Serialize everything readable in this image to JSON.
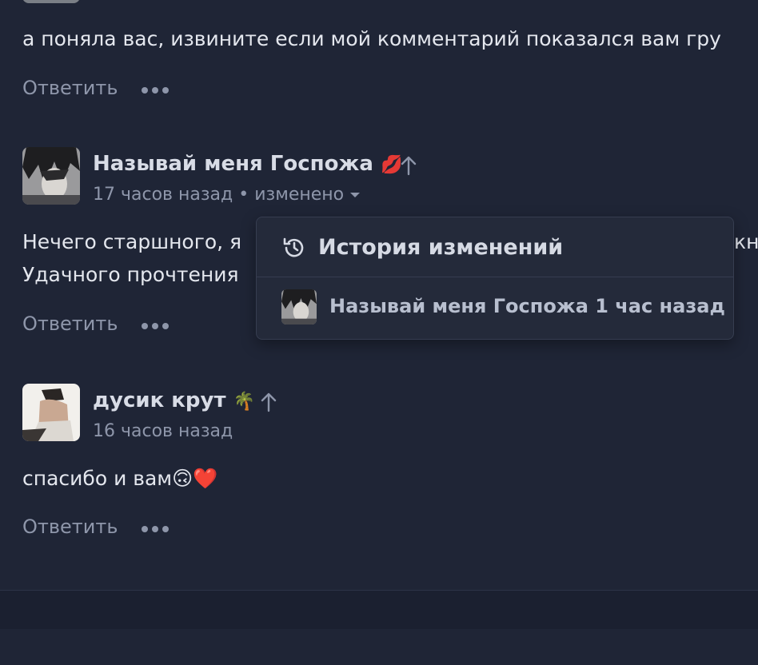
{
  "comments": [
    {
      "text": "а поняла вас, извините если мой комментарий показался вам гру",
      "reply_label": "Ответить"
    },
    {
      "author": "Называй меня Госпожа",
      "author_emoji": "💋",
      "time": "17 часов назад",
      "separator": "•",
      "edited_label": "изменено",
      "text_line1": "Нечего старшного, я",
      "text_line1_end": "кн",
      "text_line2": "Удачного прочтения",
      "reply_label": "Ответить"
    },
    {
      "author": "дусик крут",
      "author_emoji": "🌴",
      "time": "16 часов назад",
      "text": "спасибо и вам🙃❤️",
      "reply_label": "Ответить"
    }
  ],
  "edit_history": {
    "title": "История изменений",
    "items": [
      {
        "author": "Называй меня Госпожа",
        "time": "1 час назад"
      }
    ]
  },
  "icons": {
    "upvote": "arrow-up-icon",
    "more": "more-dots-icon",
    "history": "history-icon",
    "caret": "caret-down-icon"
  },
  "colors": {
    "background": "#1f2536",
    "dropdown_bg": "#242a3a",
    "muted_text": "#8e96aa"
  }
}
